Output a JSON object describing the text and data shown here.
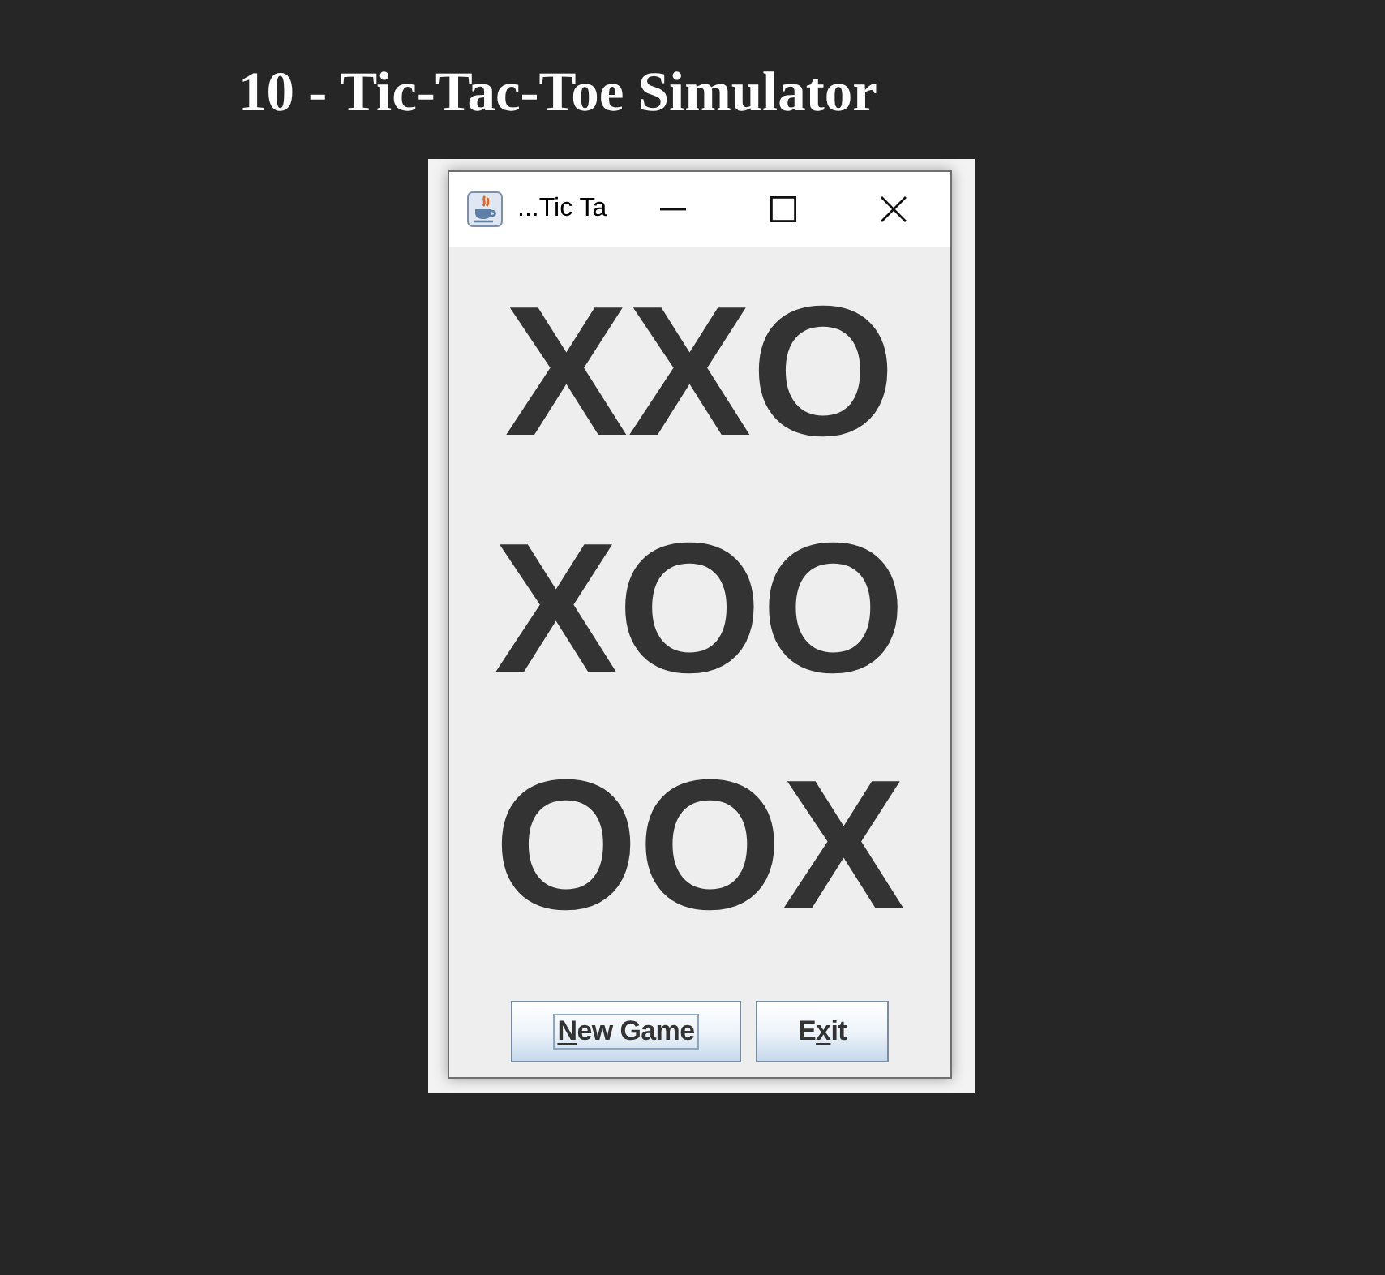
{
  "heading": "10 - Tic-Tac-Toe Simulator",
  "window": {
    "title": "...Tic Ta"
  },
  "board": [
    [
      "X",
      "X",
      "O"
    ],
    [
      "X",
      "O",
      "O"
    ],
    [
      "O",
      "O",
      "X"
    ]
  ],
  "buttons": [
    {
      "mnemonic": "N",
      "after": "ew Game",
      "focused": true
    },
    {
      "before": "E",
      "mnemonic": "x",
      "after": "it",
      "focused": false
    }
  ]
}
